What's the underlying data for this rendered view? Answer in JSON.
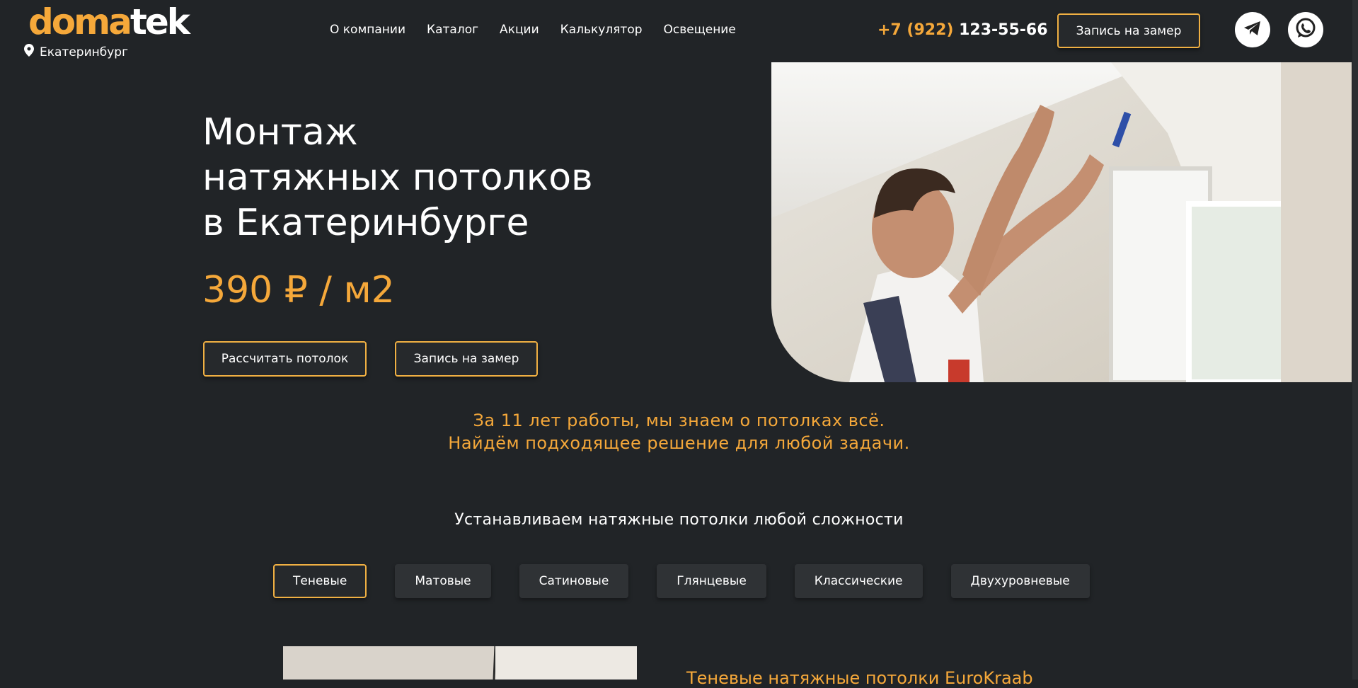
{
  "header": {
    "logo_part1": "doma",
    "logo_part2": "tek",
    "city": "Екатеринбург",
    "nav": [
      "О компании",
      "Каталог",
      "Акции",
      "Калькулятор",
      "Освещение"
    ],
    "phone_prefix": "+7 (922)",
    "phone_number": "123-55-66",
    "cta": "Запись на замер"
  },
  "hero": {
    "title_lines": [
      "Монтаж",
      "натяжных потолков",
      "в Екатеринбурге"
    ],
    "price": "390 ₽ / м2",
    "btn_calc": "Рассчитать потолок",
    "btn_measure": "Запись на замер"
  },
  "tagline": {
    "line1": "За 11 лет работы, мы знаем о потолках всё.",
    "line2": "Найдём подходящее решение для любой задачи."
  },
  "types": {
    "heading": "Устанавливаем натяжные потолки любой сложности",
    "tabs": [
      "Теневые",
      "Матовые",
      "Сатиновые",
      "Глянцевые",
      "Классические",
      "Двухуровневые"
    ],
    "active": "Теневые",
    "preview_title": "Теневые натяжные потолки EuroKraab"
  },
  "colors": {
    "accent": "#f5a83a",
    "background": "#212427"
  },
  "icons": [
    "location-pin-icon",
    "telegram-icon",
    "whatsapp-icon"
  ]
}
